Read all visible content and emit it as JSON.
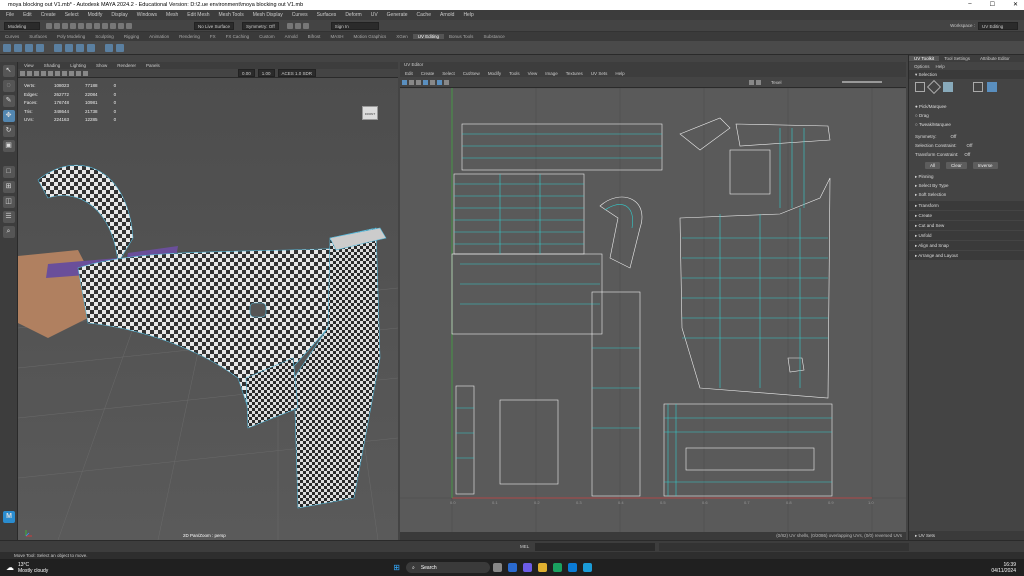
{
  "window": {
    "title": "moya blocking out V1.mb* - Autodesk MAYA 2024.2 - Educational Version: D:\\2.ue environment\\moya blocking out V1.mb",
    "minimize": "–",
    "maximize": "☐",
    "close": "✕"
  },
  "menus": [
    "File",
    "Edit",
    "Create",
    "Select",
    "Modify",
    "Display",
    "Windows",
    "Mesh",
    "Edit Mesh",
    "Mesh Tools",
    "Mesh Display",
    "Curves",
    "Surfaces",
    "Deform",
    "UV",
    "Generate",
    "Cache",
    "Arnold",
    "Help"
  ],
  "status": {
    "mode": "Modeling",
    "live_surface": "No Live Surface",
    "symmetry": "Symmetry: Off",
    "sign_in": "Sign In",
    "workspace_label": "Workspace :",
    "workspace": "UV Editing"
  },
  "shelf_tabs": [
    "Curves",
    "Surfaces",
    "Poly Modeling",
    "Sculpting",
    "Rigging",
    "Animation",
    "Rendering",
    "FX",
    "FX Caching",
    "Custom",
    "Arnold",
    "Bifrost",
    "MASH",
    "Motion Graphics",
    "XGen",
    "UV Editing",
    "Bonus Tools",
    "Substance"
  ],
  "shelf_active": "UV Editing",
  "viewport": {
    "menu": [
      "View",
      "Shading",
      "Lighting",
      "Show",
      "Renderer",
      "Panels"
    ],
    "hud": [
      [
        "Verts:",
        "108023",
        "77188",
        "0"
      ],
      [
        "Edges:",
        "262772",
        "22084",
        "0"
      ],
      [
        "Faces:",
        "176748",
        "10981",
        "0"
      ],
      [
        "Tris:",
        "348644",
        "21738",
        "0"
      ],
      [
        "UVs:",
        "224163",
        "12285",
        "0"
      ]
    ],
    "field1": "0.00",
    "field2": "1.00",
    "colorspace": "ACES 1.0 SDR",
    "camera": "2D Pan/Zoom : persp",
    "cube_label": "FRONT"
  },
  "uv_editor": {
    "title": "UV Editor",
    "menu": [
      "Edit",
      "Create",
      "Select",
      "Cut/Sew",
      "Modify",
      "Tools",
      "View",
      "Image",
      "Textures",
      "UV Sets",
      "Help"
    ],
    "shading": "Texel",
    "status": "(0/82) UV shells, (0/2086) overlapping UVs, (0/0) reversed UVs",
    "axis_ticks": [
      "0.0",
      "0.1",
      "0.2",
      "0.3",
      "0.4",
      "0.5",
      "0.6",
      "0.7",
      "0.8",
      "0.9",
      "1.0"
    ]
  },
  "uv_toolkit": {
    "tabs": [
      "UV Toolkit",
      "Tool Settings",
      "Attribute Editor"
    ],
    "options": [
      "Options",
      "Help"
    ],
    "selection_header": "Selection",
    "radios": [
      "Pick/Marquee",
      "Drag",
      "Tweak/Marquee"
    ],
    "symmetry_label": "Symmetry:",
    "symmetry_value": "Off",
    "sel_constraint_label": "Selection Constraint:",
    "sel_constraint_value": "Off",
    "transform_constraint_label": "Transform Constraint:",
    "transform_constraint_value": "Off",
    "buttons": [
      "All",
      "Clear",
      "Inverse"
    ],
    "sub_sections": [
      "Pinning",
      "Select By Type",
      "Soft Selection"
    ],
    "sections": [
      "Transform",
      "Create",
      "Cut and Sew",
      "Unfold",
      "Align and Snap",
      "Arrange and Layout"
    ],
    "uv_sets": "UV Sets"
  },
  "cmd": {
    "lang": "MEL",
    "help": "Move Tool: Select an object to move."
  },
  "taskbar": {
    "temp": "13°C",
    "weather": "Mostly cloudy",
    "search": "Search",
    "time": "16:39",
    "date": "04/11/2024"
  }
}
